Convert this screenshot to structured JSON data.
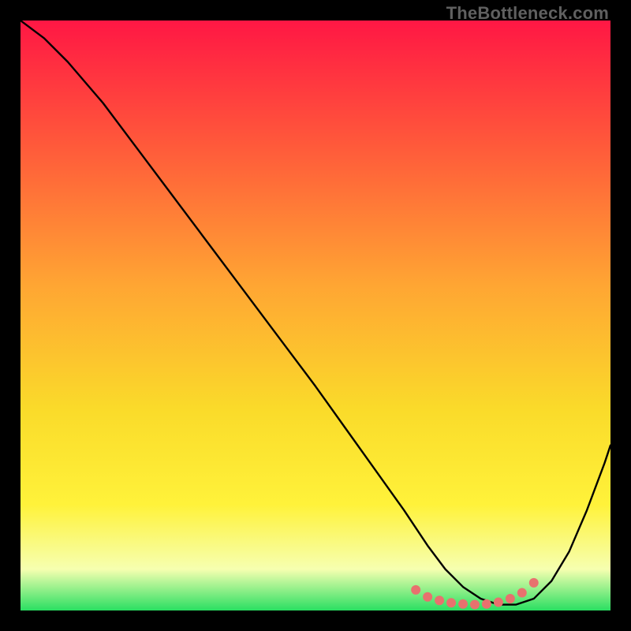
{
  "watermark": "TheBottleneck.com",
  "colors": {
    "bg": "#000000",
    "curve": "#000000",
    "dots": "#E8716E",
    "gradient_top": "#FF1744",
    "gradient_upper_mid": "#FF5C3A",
    "gradient_mid": "#FFA633",
    "gradient_lower_mid": "#FADB2A",
    "gradient_yellow": "#FFF23A",
    "gradient_pale": "#F6FFB0",
    "gradient_green": "#2ADF62"
  },
  "chart_data": {
    "type": "line",
    "title": "",
    "xlabel": "",
    "ylabel": "",
    "xlim": [
      0,
      100
    ],
    "ylim": [
      0,
      100
    ],
    "x": [
      0,
      4,
      8,
      14,
      20,
      26,
      32,
      38,
      44,
      50,
      55,
      60,
      65,
      69,
      72,
      75,
      78,
      81,
      84,
      87,
      90,
      93,
      96,
      99,
      100
    ],
    "values": [
      100,
      97,
      93,
      86,
      78,
      70,
      62,
      54,
      46,
      38,
      31,
      24,
      17,
      11,
      7,
      4,
      2,
      1,
      1,
      2,
      5,
      10,
      17,
      25,
      28
    ],
    "series": [
      {
        "name": "bottleneck-curve",
        "x": [
          0,
          4,
          8,
          14,
          20,
          26,
          32,
          38,
          44,
          50,
          55,
          60,
          65,
          69,
          72,
          75,
          78,
          81,
          84,
          87,
          90,
          93,
          96,
          99,
          100
        ],
        "values": [
          100,
          97,
          93,
          86,
          78,
          70,
          62,
          54,
          46,
          38,
          31,
          24,
          17,
          11,
          7,
          4,
          2,
          1,
          1,
          2,
          5,
          10,
          17,
          25,
          28
        ]
      }
    ],
    "optimal_zone": {
      "points_x": [
        67,
        69,
        71,
        73,
        75,
        77,
        79,
        81,
        83,
        85,
        87
      ],
      "points_y": [
        3.5,
        2.3,
        1.7,
        1.3,
        1.1,
        1.0,
        1.1,
        1.4,
        2.0,
        3.0,
        4.7
      ]
    }
  }
}
